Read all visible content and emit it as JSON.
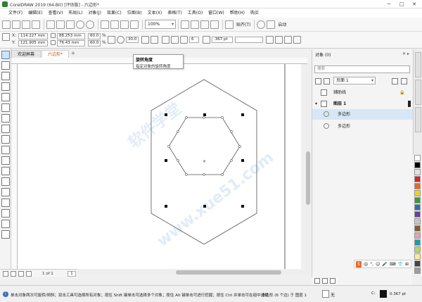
{
  "window": {
    "title": "CorelDRAW 2019 (64-Bit) [评估版] - 六边形*",
    "minimize": "─",
    "maximize": "□",
    "close": "✕"
  },
  "menu": [
    "文件(F)",
    "编辑(E)",
    "查看(V)",
    "布局(L)",
    "对象(J)",
    "效果(C)",
    "位图(B)",
    "文本(X)",
    "表格(T)",
    "工具(O)",
    "窗口(W)",
    "帮助(H)",
    "购买"
  ],
  "toolbar": {
    "zoom": "100%",
    "snap_label": "贴齐(T)",
    "launch_label": "启动"
  },
  "propbar": {
    "x_label": "X:",
    "x_value": "114.227 mm",
    "y_label": "Y:",
    "y_value": "121.905 mm",
    "w_value": "88.253 mm",
    "h_value": "76.43 mm",
    "scale_w": "60.0",
    "scale_h": "60.0",
    "pct": "%",
    "rotation": "30.0",
    "sides": "6",
    "outline_width": ".367 pt"
  },
  "tooltip": {
    "title": "旋转角度",
    "desc": "指定对象的旋转角度"
  },
  "tabs": {
    "welcome": "欢迎屏幕",
    "doc": "六边形*",
    "add": "+"
  },
  "pagebar": {
    "count": "1 of 1",
    "page": "1"
  },
  "docker": {
    "title": "对象 (0)",
    "search_placeholder": "搜索",
    "page": "页面 1",
    "guides": "辅助线",
    "layer": "图层 1",
    "items": [
      "多边形",
      "多边形"
    ]
  },
  "ime": {
    "logo": "S",
    "items": [
      "中",
      "°,",
      "☺",
      "🎤",
      "⌨",
      "👕",
      "⊞"
    ]
  },
  "status": {
    "info": "i",
    "hint": "单击对象两次可旋转/倾斜；双击工具可选择所有对象；按住 Shift 键单击可选择多个对象；按住 Alt 键单击可进行挖掘；按住 Ctrl 并单击可在组中选择",
    "selection": "多边形 (6 个边) 于 图层 1",
    "fill": "无",
    "color_label": "C:",
    "width": "0.367 pt"
  },
  "palette": [
    "#ffffff",
    "#000000",
    "#e3e3e3",
    "#d12727",
    "#e86a1f",
    "#f2d11a",
    "#3a9b3c",
    "#2f6fb5",
    "#6b3fa0",
    "#c6c6c6",
    "#8a5a2b",
    "#ef9ab8",
    "#1a9fa5",
    "#b7d85a",
    "#f7ec9a",
    "#444444",
    "#9d9d9d"
  ],
  "watermark": [
    "软件学堂",
    "www.xue51.com"
  ]
}
